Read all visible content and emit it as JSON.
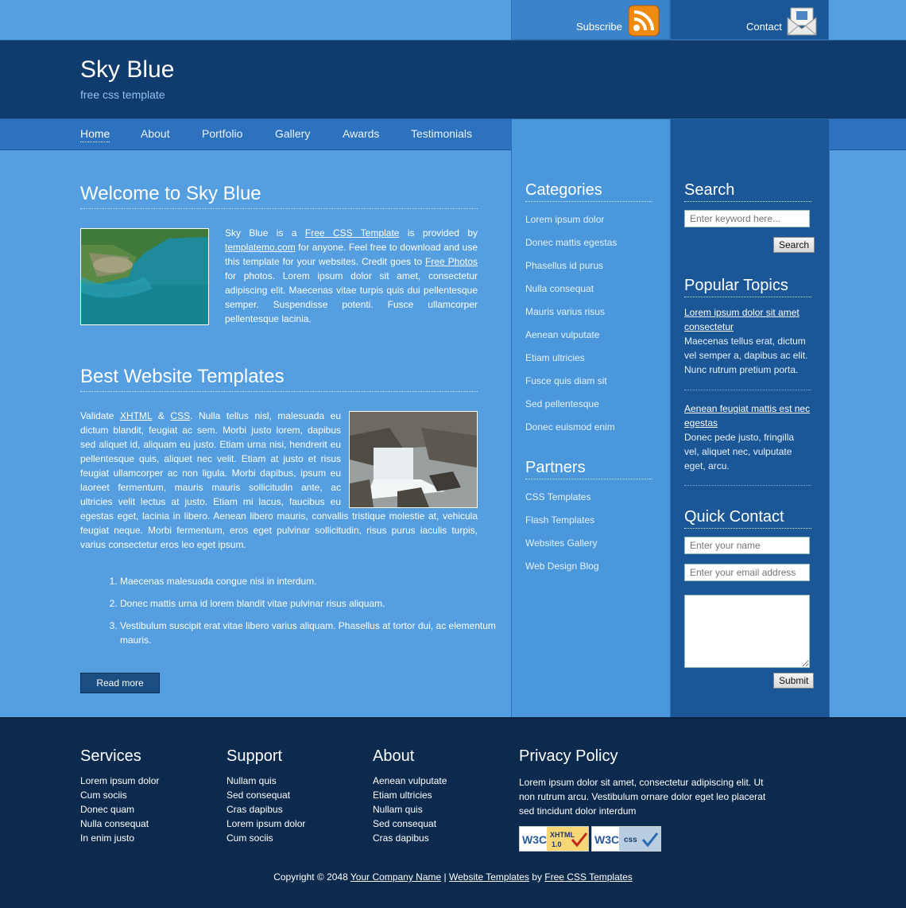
{
  "topbar": {
    "subscribe": "Subscribe",
    "contact": "Contact"
  },
  "header": {
    "title": "Sky Blue",
    "subtitle": "free css template"
  },
  "nav": [
    "Home",
    "About",
    "Portfolio",
    "Gallery",
    "Awards",
    "Testimonials"
  ],
  "welcome": {
    "title": "Welcome to Sky Blue",
    "p1": "Sky Blue is a ",
    "link1": "Free CSS Template",
    "p2": " is provided by ",
    "link2": "templatemo.com",
    "p3": " for anyone. Feel free to download and use this template for your websites. Credit goes to ",
    "link3": "Free Photos",
    "p4": " for photos. Lorem ipsum dolor sit amet, consectetur adipiscing elit. Maecenas vitae turpis quis dui pellentesque semper. Suspendisse potenti. Fusce ullamcorper pellentesque lacinia."
  },
  "best": {
    "title": "Best Website Templates",
    "p1": "Validate ",
    "link1": "XHTML",
    "amp": " & ",
    "link2": "CSS",
    "p2": ". Nulla tellus nisl, malesuada eu dictum blandit, feugiat ac sem. Morbi justo lorem, dapibus sed aliquet id, aliquam eu justo. Etiam urna nisi, hendrerit eu pellentesque quis, aliquet nec velit. Etiam at justo et risus feugiat ullamcorper ac non ligula. Morbi dapibus, ipsum eu laoreet fermentum, mauris mauris sollicitudin ante, ac ultricies velit lectus at justo. Etiam mi lacus, faucibus eu egestas eget, lacinia in libero. Aenean libero mauris, convallis tristique molestie at, vehicula feugiat neque. Morbi fermentum, eros eget pulvinar sollicitudin, risus purus iaculis turpis, varius consectetur eros leo eget ipsum."
  },
  "ordered_list": [
    "Maecenas malesuada congue nisi in interdum.",
    "Donec mattis urna id lorem blandit vitae pulvinar risus aliquam.",
    "Vestibulum suscipit erat vitae libero varius aliquam. Phasellus at tortor dui, ac elementum mauris."
  ],
  "read_more": "Read more",
  "categories": {
    "title": "Categories",
    "items": [
      "Lorem ipsum dolor",
      "Donec mattis egestas",
      "Phasellus id purus",
      "Nulla consequat",
      "Mauris varius risus",
      "Aenean vulputate",
      "Etiam ultricies",
      "Fusce quis diam sit",
      "Sed pellentesque",
      "Donec euismod enim"
    ]
  },
  "partners": {
    "title": "Partners",
    "items": [
      "CSS Templates",
      "Flash Templates",
      "Websites Gallery",
      "Web Design Blog"
    ]
  },
  "search": {
    "title": "Search",
    "placeholder": "Enter keyword here...",
    "button": "Search"
  },
  "popular": {
    "title": "Popular Topics",
    "topics": [
      {
        "title": "Lorem ipsum dolor sit amet consectetur",
        "body": "Maecenas tellus erat, dictum vel semper a, dapibus ac elit. Nunc rutrum pretium porta."
      },
      {
        "title": "Aenean feugiat mattis est nec egestas",
        "body": "Donec pede justo, fringilla vel, aliquet nec, vulputate eget, arcu."
      }
    ]
  },
  "quick_contact": {
    "title": "Quick Contact",
    "name_placeholder": "Enter your name",
    "email_placeholder": "Enter your email address",
    "submit": "Submit"
  },
  "footer": {
    "services": {
      "title": "Services",
      "items": [
        "Lorem ipsum dolor",
        "Cum sociis",
        "Donec quam",
        "Nulla consequat",
        "In enim justo"
      ]
    },
    "support": {
      "title": "Support",
      "items": [
        "Nullam quis",
        "Sed consequat",
        "Cras dapibus",
        "Lorem ipsum dolor",
        "Cum sociis"
      ]
    },
    "about": {
      "title": "About",
      "items": [
        "Aenean vulputate",
        "Etiam ultricies",
        "Nullam quis",
        "Sed consequat",
        "Cras dapibus"
      ]
    },
    "privacy": {
      "title": "Privacy Policy",
      "text": "Lorem ipsum dolor sit amet, consectetur adipiscing elit. Ut non rutrum arcu. Vestibulum ornare dolor eget leo placerat sed tincidunt dolor interdum",
      "badge_xhtml": "W3C XHTML 1.0",
      "badge_css": "W3C CSS"
    },
    "copyright": {
      "prefix": "Copyright © 2048 ",
      "company": "Your Company Name",
      "sep": " | ",
      "templates": "Website Templates",
      "by": " by ",
      "free": "Free CSS Templates"
    }
  }
}
